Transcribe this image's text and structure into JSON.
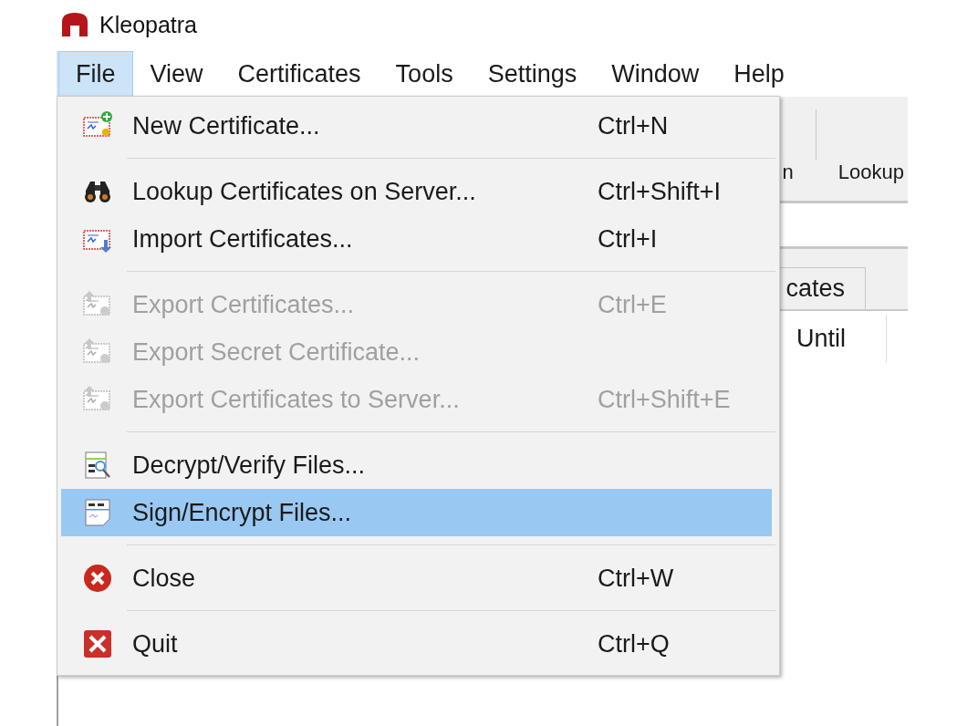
{
  "window": {
    "title": "Kleopatra"
  },
  "menubar": [
    {
      "label": "File",
      "selected": true
    },
    {
      "label": "View",
      "selected": false
    },
    {
      "label": "Certificates",
      "selected": false
    },
    {
      "label": "Tools",
      "selected": false
    },
    {
      "label": "Settings",
      "selected": false
    },
    {
      "label": "Window",
      "selected": false
    },
    {
      "label": "Help",
      "selected": false
    }
  ],
  "toolbar": {
    "items": [
      "n",
      "Lookup"
    ]
  },
  "tabs": [
    {
      "label": "cates"
    }
  ],
  "table": {
    "columns": [
      "Until"
    ]
  },
  "menu": {
    "items": [
      {
        "kind": "item",
        "label": "New Certificate...",
        "shortcut": "Ctrl+N",
        "disabled": false,
        "selected": false
      },
      {
        "kind": "separator"
      },
      {
        "kind": "item",
        "label": "Lookup Certificates on Server...",
        "shortcut": "Ctrl+Shift+I",
        "disabled": false,
        "selected": false
      },
      {
        "kind": "item",
        "label": "Import Certificates...",
        "shortcut": "Ctrl+I",
        "disabled": false,
        "selected": false
      },
      {
        "kind": "separator"
      },
      {
        "kind": "item",
        "label": "Export Certificates...",
        "shortcut": "Ctrl+E",
        "disabled": true,
        "selected": false
      },
      {
        "kind": "item",
        "label": "Export Secret Certificate...",
        "disabled": true,
        "selected": false
      },
      {
        "kind": "item",
        "label": "Export Certificates to Server...",
        "shortcut": "Ctrl+Shift+E",
        "disabled": true,
        "selected": false
      },
      {
        "kind": "separator"
      },
      {
        "kind": "item",
        "label": "Decrypt/Verify Files...",
        "disabled": false,
        "selected": false
      },
      {
        "kind": "item",
        "label": "Sign/Encrypt Files...",
        "disabled": false,
        "selected": true
      },
      {
        "kind": "separator"
      },
      {
        "kind": "item",
        "label": "Close",
        "shortcut": "Ctrl+W",
        "disabled": false,
        "selected": false
      },
      {
        "kind": "separator"
      },
      {
        "kind": "item",
        "label": "Quit",
        "shortcut": "Ctrl+Q",
        "disabled": false,
        "selected": false
      }
    ]
  }
}
